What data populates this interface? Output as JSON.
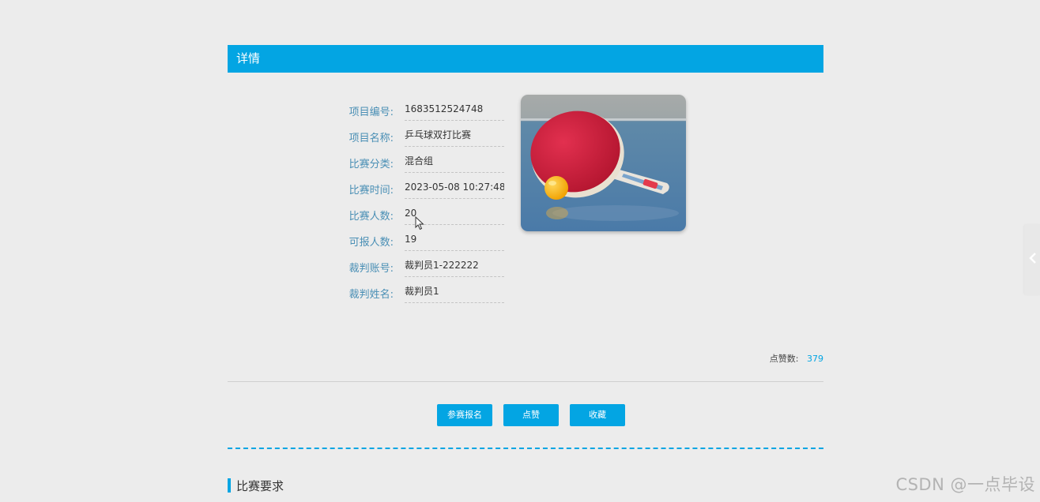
{
  "header": {
    "title": "详情"
  },
  "fields": [
    {
      "label": "项目编号:",
      "value": "1683512524748"
    },
    {
      "label": "项目名称:",
      "value": "乒乓球双打比赛"
    },
    {
      "label": "比赛分类:",
      "value": "混合组"
    },
    {
      "label": "比赛时间:",
      "value": "2023-05-08 10:27:48"
    },
    {
      "label": "比赛人数:",
      "value": "20"
    },
    {
      "label": "可报人数:",
      "value": "19"
    },
    {
      "label": "裁判账号:",
      "value": "裁判员1-222222"
    },
    {
      "label": "裁判姓名:",
      "value": "裁判员1"
    }
  ],
  "likes": {
    "label": "点赞数:",
    "count": "379"
  },
  "actions": {
    "register": "参赛报名",
    "like": "点赞",
    "favorite": "收藏"
  },
  "section": {
    "title": "比赛要求"
  },
  "watermark": "CSDN @一点毕设",
  "colors": {
    "accent": "#03a5e3",
    "label": "#4a8fb5"
  },
  "image": {
    "subject": "table-tennis-paddle-image"
  }
}
